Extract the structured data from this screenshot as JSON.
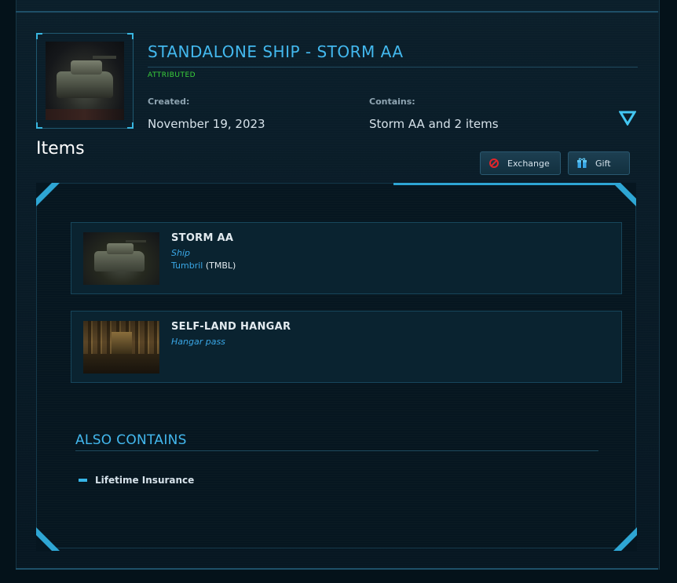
{
  "pledge": {
    "title": "STANDALONE SHIP - STORM AA",
    "status": "ATTRIBUTED",
    "created_label": "Created:",
    "created_value": "November 19, 2023",
    "contains_label": "Contains:",
    "contains_value": "Storm AA and 2 items",
    "thumbnail_icon": "storm-aa-ship-image"
  },
  "items_section": {
    "heading": "Items",
    "buttons": {
      "exchange_label": "Exchange",
      "exchange_icon": "no-entry-icon",
      "gift_label": "Gift",
      "gift_icon": "gift-box-icon"
    },
    "items": [
      {
        "name": "STORM AA",
        "type": "Ship",
        "manufacturer": "Tumbril",
        "manufacturer_code": "(TMBL)",
        "image": "storm-aa-ship-image"
      },
      {
        "name": "SELF-LAND HANGAR",
        "type": "Hangar pass",
        "image": "hangar-image"
      }
    ]
  },
  "also_contains": {
    "heading": "ALSO CONTAINS",
    "items": [
      "Lifetime Insurance"
    ]
  },
  "colors": {
    "accent": "#43b8ee",
    "status_green": "#3bd13b",
    "exchange_icon_red": "#e0262b",
    "background": "#04121a"
  }
}
